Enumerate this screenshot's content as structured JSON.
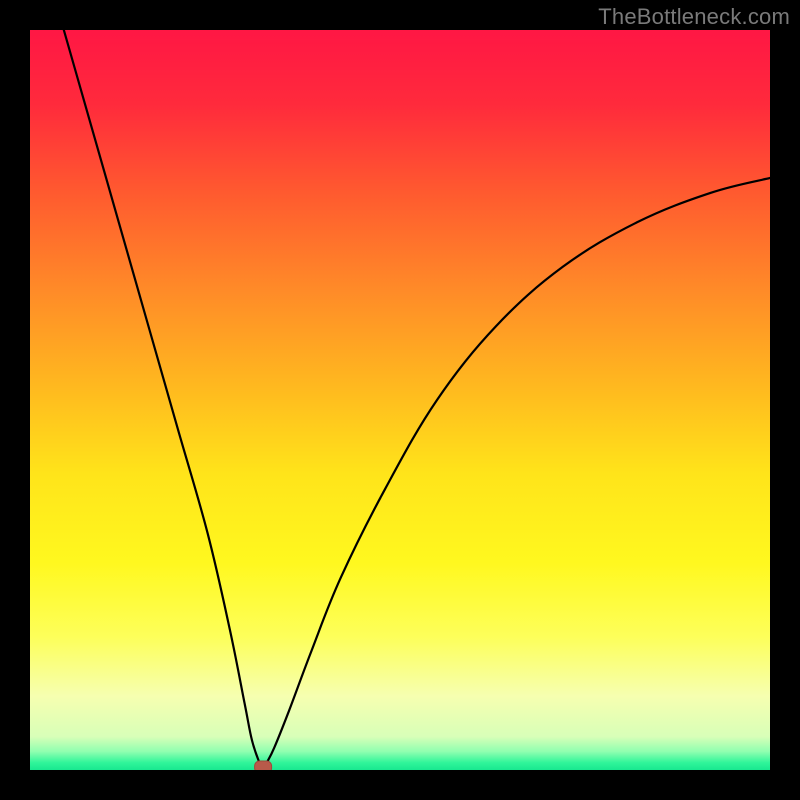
{
  "watermark": "TheBottleneck.com",
  "colors": {
    "frame": "#000000",
    "curve": "#000000",
    "marker_fill": "#b85a4a",
    "marker_stroke": "#a04a3c",
    "gradient_stops": [
      {
        "offset": 0.0,
        "color": "#ff1744"
      },
      {
        "offset": 0.1,
        "color": "#ff2a3c"
      },
      {
        "offset": 0.22,
        "color": "#ff5a2f"
      },
      {
        "offset": 0.35,
        "color": "#ff8a28"
      },
      {
        "offset": 0.48,
        "color": "#ffb81f"
      },
      {
        "offset": 0.6,
        "color": "#ffe41a"
      },
      {
        "offset": 0.72,
        "color": "#fff81f"
      },
      {
        "offset": 0.82,
        "color": "#fdff5a"
      },
      {
        "offset": 0.9,
        "color": "#f6ffb0"
      },
      {
        "offset": 0.955,
        "color": "#d8ffb8"
      },
      {
        "offset": 0.975,
        "color": "#90ffb0"
      },
      {
        "offset": 0.99,
        "color": "#30f59a"
      },
      {
        "offset": 1.0,
        "color": "#18e890"
      }
    ]
  },
  "chart_data": {
    "type": "line",
    "title": "",
    "xlabel": "",
    "ylabel": "",
    "xlim": [
      0,
      100
    ],
    "ylim": [
      0,
      100
    ],
    "grid": false,
    "legend": false,
    "marker": {
      "x": 31.5,
      "y": 0,
      "shape": "rounded-rect"
    },
    "series": [
      {
        "name": "bottleneck-curve",
        "x": [
          0,
          4,
          8,
          12,
          16,
          20,
          24,
          27,
          29,
          30,
          31,
          31.5,
          32,
          33,
          35,
          38,
          42,
          48,
          55,
          63,
          72,
          82,
          92,
          100
        ],
        "y": [
          116,
          102,
          88,
          74,
          60,
          46,
          32,
          19,
          9,
          4,
          1,
          0,
          1,
          3,
          8,
          16,
          26,
          38,
          50,
          60,
          68,
          74,
          78,
          80
        ]
      }
    ],
    "notes": "V-shaped curve with sharp minimum near x≈31.5; left branch near-linear from off-top, right branch rises with decreasing slope; y values are percent of plot height from bottom, read off pixel positions."
  }
}
